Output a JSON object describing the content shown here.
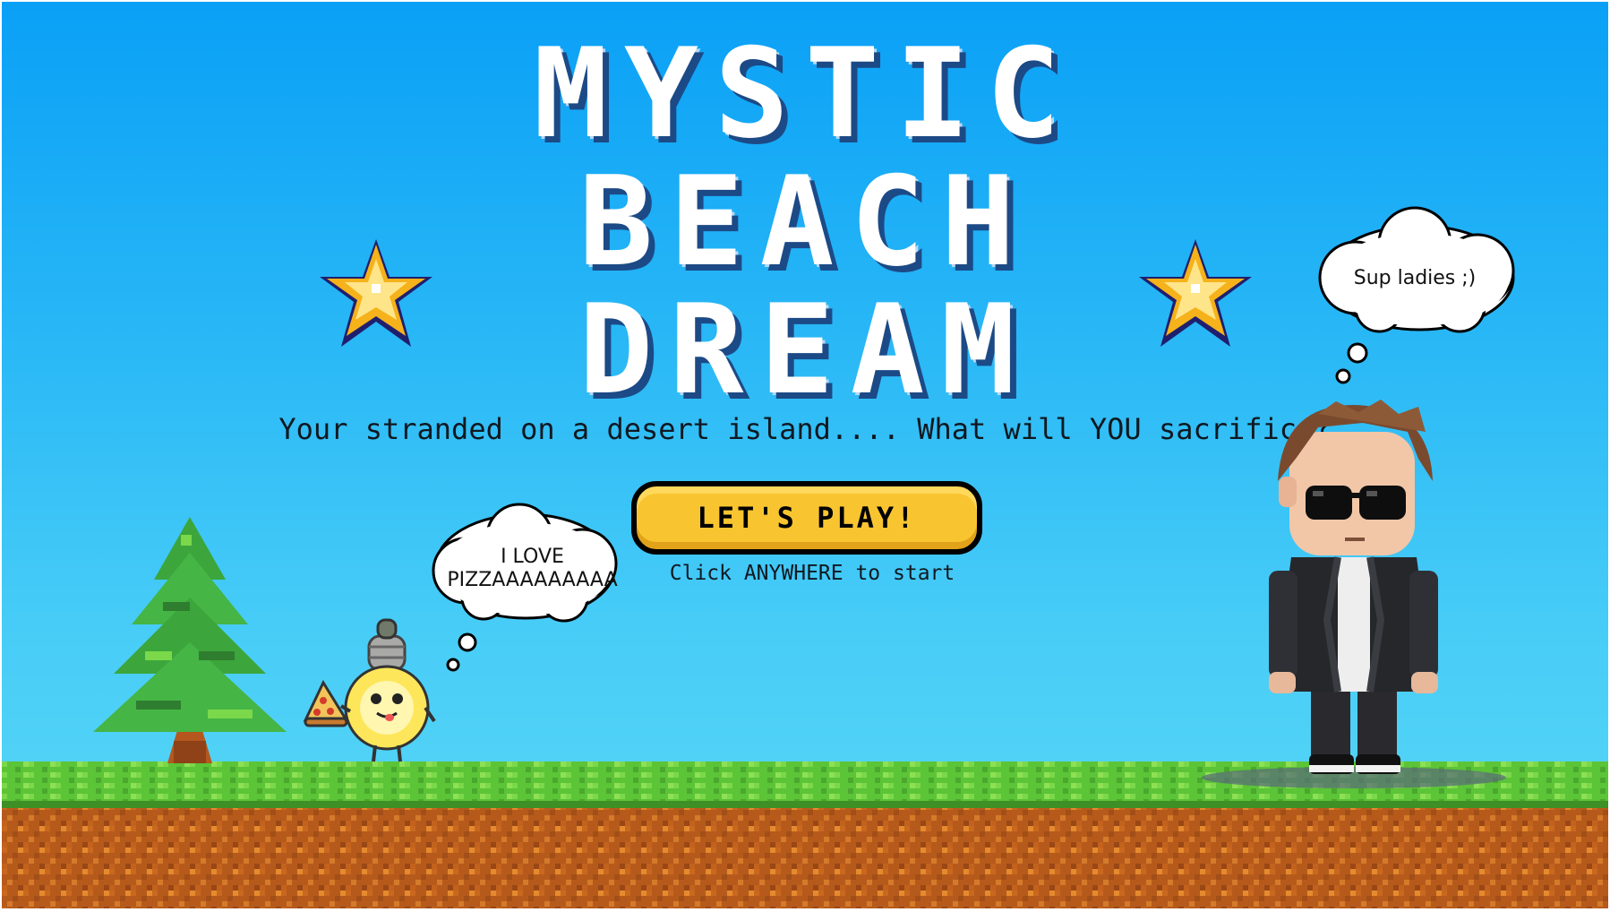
{
  "title": {
    "line1": "MYSTIC",
    "line2": "BEACH",
    "line3": "DREAM"
  },
  "subtitle": "Your stranded on a desert island.... What will YOU sacrifice?",
  "play_button": {
    "label": "LET'S PLAY!"
  },
  "hint": "Click ANYWHERE to start",
  "bulb_thought": {
    "line1": "I LOVE",
    "line2": "PIZZAAAAAAAAA"
  },
  "guy_thought": "Sup ladies ;)",
  "colors": {
    "sky_top": "#0aa0f6",
    "sky_bottom": "#5ad8f6",
    "button": "#f8c531",
    "grass": "#5cc437",
    "dirt": "#b65a1c"
  },
  "icons": [
    "star-icon-left",
    "star-icon-right",
    "pine-tree",
    "lightbulb-character",
    "pizza-slice-icon",
    "sunglasses-guy-character"
  ]
}
